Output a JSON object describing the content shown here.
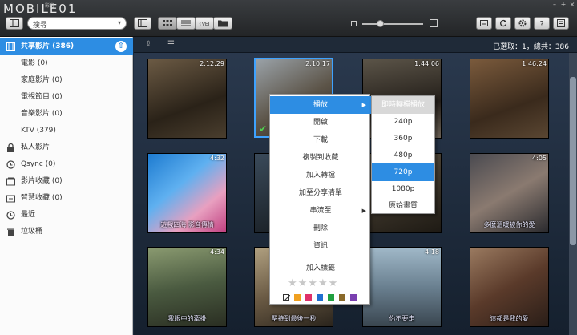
{
  "app": {
    "logo": "MOBILE01",
    "logo_sub": "影音"
  },
  "toolbar": {
    "search_value": "搜尋",
    "view_icons": [
      "thumbnail-view-icon",
      "list-view-icon",
      "timeline-view-icon",
      "folder-view-icon"
    ],
    "right_icons": [
      "slideshow-icon",
      "refresh-icon",
      "settings-icon",
      "help-icon",
      "more-icon"
    ]
  },
  "sidebar": {
    "items": [
      {
        "label": "共享影片 (386)",
        "icon": "video-library-icon",
        "selected": true
      },
      {
        "label": "電影 (0)",
        "sub": true
      },
      {
        "label": "家庭影片 (0)",
        "sub": true
      },
      {
        "label": "電視節目 (0)",
        "sub": true
      },
      {
        "label": "音樂影片 (0)",
        "sub": true
      },
      {
        "label": "KTV (379)",
        "sub": true
      },
      {
        "label": "私人影片",
        "icon": "lock-icon"
      },
      {
        "label": "Qsync (0)",
        "icon": "qsync-icon"
      },
      {
        "label": "影片收藏 (0)",
        "icon": "collection-icon"
      },
      {
        "label": "智慧收藏 (0)",
        "icon": "smart-collection-icon"
      },
      {
        "label": "最近",
        "icon": "clock-icon"
      },
      {
        "label": "垃圾桶",
        "icon": "trash-icon"
      }
    ]
  },
  "main": {
    "status": "已選取：1，總共：386",
    "thumbs": [
      {
        "duration": "2:12:29",
        "caption": ""
      },
      {
        "duration": "2:10:17",
        "caption": "",
        "selected": true
      },
      {
        "duration": "1:44:06",
        "caption": ""
      },
      {
        "duration": "1:46:24",
        "caption": ""
      },
      {
        "duration": "4:32",
        "caption": "遊戲四海 影音傳情"
      },
      {
        "duration": "",
        "caption": ""
      },
      {
        "duration": "",
        "caption": ""
      },
      {
        "duration": "4:05",
        "caption": "多麼溫暖被你的愛"
      },
      {
        "duration": "4:34",
        "caption": "我眼中的牽掛"
      },
      {
        "duration": "",
        "caption": "堅持到最後一秒"
      },
      {
        "duration": "4:18",
        "caption": "你不要走"
      },
      {
        "duration": "",
        "caption": "這都是我的愛"
      }
    ]
  },
  "context_menu": {
    "items": [
      {
        "label": "播放",
        "has_sub": true,
        "highlight": true
      },
      {
        "label": "開啟"
      },
      {
        "label": "下載"
      },
      {
        "label": "複製到收藏"
      },
      {
        "label": "加入轉檔"
      },
      {
        "label": "加至分享清單"
      },
      {
        "label": "串流至",
        "has_sub": true
      },
      {
        "label": "刪除"
      },
      {
        "label": "資訊"
      },
      {
        "label": "加入標籤"
      }
    ],
    "rating_stars": "★★★★★",
    "swatch_colors": [
      "#ffffff",
      "#f0a020",
      "#e0306a",
      "#2070d0",
      "#20a040",
      "#8a6a2a",
      "#7a40b0"
    ]
  },
  "submenu": {
    "items": [
      {
        "label": "即時轉檔播放",
        "header": true
      },
      {
        "label": "240p"
      },
      {
        "label": "360p"
      },
      {
        "label": "480p"
      },
      {
        "label": "720p",
        "highlight": true
      },
      {
        "label": "1080p"
      },
      {
        "label": "原始畫質"
      }
    ]
  }
}
